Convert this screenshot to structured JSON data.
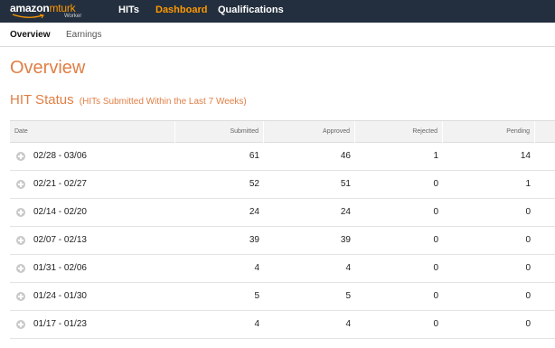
{
  "brand": {
    "name_part1": "amazon",
    "name_part2": "mturk",
    "subtitle": "Worker"
  },
  "colors": {
    "navbar": "#232f3e",
    "accent": "#ff9900",
    "heading": "#e07f45"
  },
  "nav": {
    "items": [
      {
        "label": "HITs",
        "active": false
      },
      {
        "label": "Dashboard",
        "active": true
      },
      {
        "label": "Qualifications",
        "active": false
      }
    ]
  },
  "subnav": {
    "items": [
      {
        "label": "Overview",
        "active": true
      },
      {
        "label": "Earnings",
        "active": false
      }
    ]
  },
  "page": {
    "title": "Overview",
    "section_title": "HIT Status",
    "section_note": "(HITs Submitted Within the Last 7 Weeks)"
  },
  "table": {
    "columns": [
      "Date",
      "Submitted",
      "Approved",
      "Rejected",
      "Pending"
    ],
    "rows": [
      {
        "date": "02/28 - 03/06",
        "submitted": "61",
        "approved": "46",
        "rejected": "1",
        "pending": "14"
      },
      {
        "date": "02/21 - 02/27",
        "submitted": "52",
        "approved": "51",
        "rejected": "0",
        "pending": "1"
      },
      {
        "date": "02/14 - 02/20",
        "submitted": "24",
        "approved": "24",
        "rejected": "0",
        "pending": "0"
      },
      {
        "date": "02/07 - 02/13",
        "submitted": "39",
        "approved": "39",
        "rejected": "0",
        "pending": "0"
      },
      {
        "date": "01/31 - 02/06",
        "submitted": "4",
        "approved": "4",
        "rejected": "0",
        "pending": "0"
      },
      {
        "date": "01/24 - 01/30",
        "submitted": "5",
        "approved": "5",
        "rejected": "0",
        "pending": "0"
      },
      {
        "date": "01/17 - 01/23",
        "submitted": "4",
        "approved": "4",
        "rejected": "0",
        "pending": "0"
      }
    ]
  }
}
